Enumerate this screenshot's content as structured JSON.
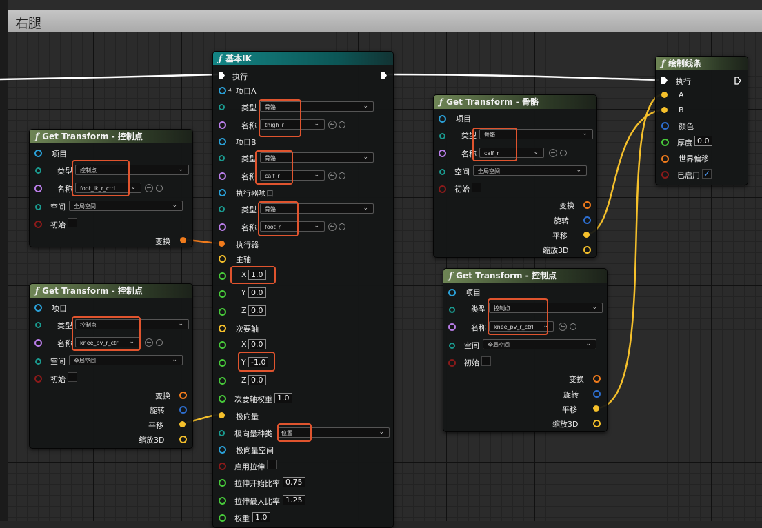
{
  "comment": {
    "title": "右腿"
  },
  "colors": {
    "pin_struct": "#2a9fd6",
    "pin_name": "#b97de8",
    "pin_enum": "#1a9a8f",
    "pin_bool": "#8a1a1a",
    "pin_transform": "#f07b1c",
    "pin_rotator": "#2d6ecf",
    "pin_vector": "#f5c02b",
    "pin_float": "#47c83a",
    "wire_exec": "#ffffff",
    "wire_vector": "#f5c02b",
    "wire_transform": "#f07b1c",
    "highlight": "#e0542e"
  },
  "icons": {
    "function": "function-icon",
    "exec": "exec-pin-icon",
    "reset": "reset-arrow-icon",
    "browse": "search-icon",
    "dropdown": "chevron-down-icon",
    "check": "checkmark-icon"
  },
  "basic_ik": {
    "title": "基本IK",
    "exec": "执行",
    "item_a": "项目A",
    "item_b": "项目B",
    "effector_item": "执行器项目",
    "type": "类型",
    "name": "名称",
    "bone": "骨骼",
    "thigh": "thigh_r",
    "calf": "calf_r",
    "foot": "foot_r",
    "effector": "执行器",
    "primary_axis": "主轴",
    "secondary_axis": "次要轴",
    "x": "X",
    "y": "Y",
    "z": "Z",
    "p_x": "1.0",
    "p_y": "0.0",
    "p_z": "0.0",
    "s_x": "0.0",
    "s_y": "-1.0",
    "s_z": "0.0",
    "secondary_weight_label": "次要轴权重",
    "secondary_weight": "1.0",
    "pole_vector": "极向量",
    "pole_vector_kind_label": "极向量种类",
    "pole_vector_kind": "位置",
    "pole_vector_space": "极向量空间",
    "enable_stretch": "启用拉伸",
    "stretch_start_label": "拉伸开始比率",
    "stretch_start": "0.75",
    "stretch_max_label": "拉伸最大比率",
    "stretch_max": "1.25",
    "weight_label": "权重",
    "weight": "1.0"
  },
  "gt_control_1": {
    "title": "Get Transform - 控制点",
    "item": "项目",
    "type": "类型",
    "type_value": "控制点",
    "name": "名称",
    "name_value": "foot_ik_r_ctrl",
    "space": "空间",
    "space_value": "全局空间",
    "initial": "初始",
    "transform": "变换"
  },
  "gt_control_2": {
    "title": "Get Transform - 控制点",
    "item": "项目",
    "type": "类型",
    "type_value": "控制点",
    "name": "名称",
    "name_value": "knee_pv_r_ctrl",
    "space": "空间",
    "space_value": "全局空间",
    "initial": "初始",
    "transform": "变换",
    "rotation": "旋转",
    "translation": "平移",
    "scale": "缩放3D"
  },
  "gt_bone": {
    "title": "Get Transform - 骨骼",
    "item": "项目",
    "type": "类型",
    "type_value": "骨骼",
    "name": "名称",
    "name_value": "calf_r",
    "space": "空间",
    "space_value": "全局空间",
    "initial": "初始",
    "transform": "变换",
    "rotation": "旋转",
    "translation": "平移",
    "scale": "缩放3D"
  },
  "gt_control_3": {
    "title": "Get Transform - 控制点",
    "item": "项目",
    "type": "类型",
    "type_value": "控制点",
    "name": "名称",
    "name_value": "knee_pv_r_ctrl",
    "space": "空间",
    "space_value": "全局空间",
    "initial": "初始",
    "transform": "变换",
    "rotation": "旋转",
    "translation": "平移",
    "scale": "缩放3D"
  },
  "draw_line": {
    "title": "绘制线条",
    "exec": "执行",
    "a": "A",
    "b": "B",
    "color": "颜色",
    "thickness_label": "厚度",
    "thickness": "0.0",
    "world_offset": "世界偏移",
    "enabled": "已启用",
    "enabled_check": "✓"
  }
}
